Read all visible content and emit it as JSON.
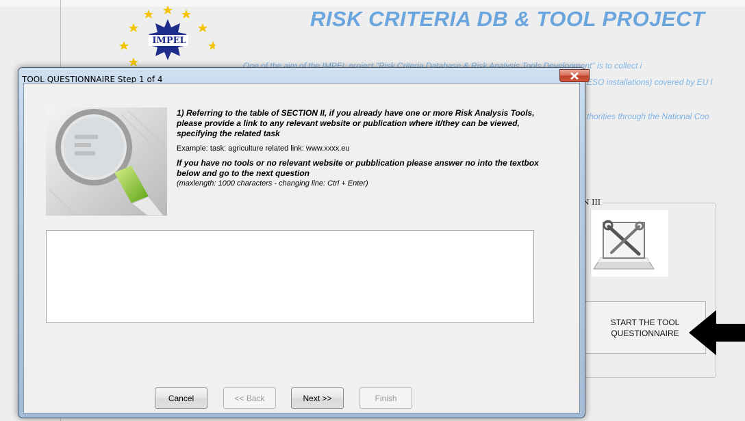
{
  "background": {
    "title": "RISK CRITERIA DB & TOOL PROJECT",
    "text_lines": [
      "One of the aim of the IMPEL project \"Risk Criteria Database & Risk Analysis Tools Development\" is to collect i",
      "ESO installations) covered by EU l",
      "thorities through the National Coo"
    ],
    "logo_text": "IMPEL",
    "section_label": "N III",
    "start_button_label": "START THE TOOL QUESTIONNAIRE",
    "colors": {
      "title": "#6aa6dd",
      "body_text": "#7fb5e6"
    }
  },
  "dialog": {
    "title": "TOOL QUESTIONNAIRE Step 1 of 4",
    "close_icon": "close-icon",
    "question": "1) Referring to the table of SECTION II, if you already have one or more Risk Analysis Tools, please provide a link to any relevant website or publication where it/they can be viewed, specifying the related task",
    "example": "Example: task: agriculture related link: www.xxxx.eu",
    "note": "If you have no tools or no relevant website or pubblication please answer no into the textbox below and go to the next question",
    "hint": "(maxlength: 1000 characters - changing line: Ctrl + Enter)",
    "answer_value": "",
    "buttons": {
      "cancel": "Cancel",
      "back": "<< Back",
      "next": "Next >>",
      "finish": "Finish"
    }
  }
}
